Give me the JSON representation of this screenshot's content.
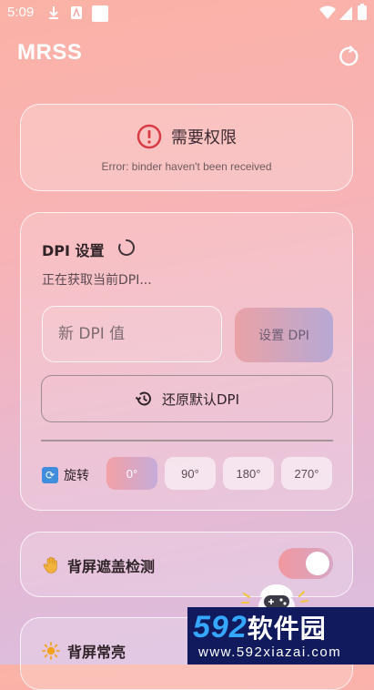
{
  "status_bar": {
    "time": "5:09"
  },
  "app": {
    "title": "MRSS"
  },
  "permission": {
    "title": "需要权限",
    "error": "Error: binder haven't been received"
  },
  "dpi": {
    "title": "DPI 设置",
    "status": "正在获取当前DPI...",
    "input_placeholder": "新 DPI 值",
    "set_label": "设置 DPI",
    "restore_label": "还原默认DPI"
  },
  "rotation": {
    "label": "旋转",
    "options": [
      "0°",
      "90°",
      "180°",
      "270°"
    ],
    "selected": "0°"
  },
  "cover_detection": {
    "label": "背屏遮盖检测",
    "enabled": true
  },
  "always_on": {
    "label": "背屏常亮"
  },
  "watermark": {
    "big_num": "592",
    "big_cn": "软件园",
    "small": "www.592xiazai.com"
  },
  "colors": {
    "accent": "#f198a0",
    "error": "#d93b44"
  }
}
